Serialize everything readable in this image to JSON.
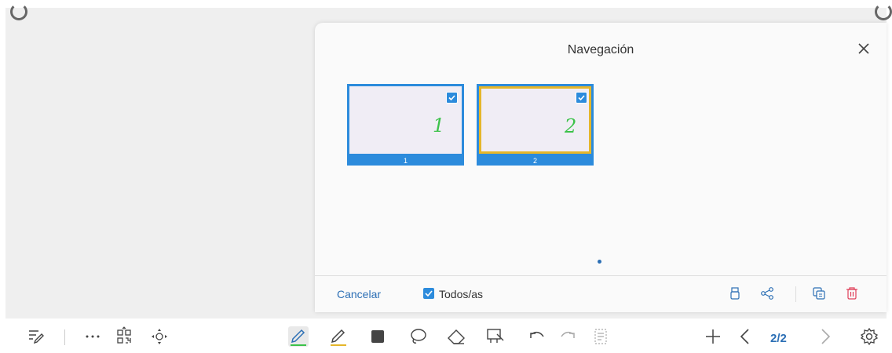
{
  "panel": {
    "title": "Navegación",
    "pages": [
      {
        "number": "1",
        "handwriting": "1",
        "checked": true,
        "active": false
      },
      {
        "number": "2",
        "handwriting": "2",
        "checked": true,
        "active": true
      }
    ]
  },
  "footer": {
    "cancel_label": "Cancelar",
    "select_all_label": "Todos/as"
  },
  "toolbar": {
    "page_indicator": "2/2"
  },
  "colors": {
    "accent": "#2c8bdc",
    "active_border": "#e5b62a",
    "link": "#2c6fb5",
    "ink": "#3cc24a",
    "delete": "#e0405a"
  }
}
